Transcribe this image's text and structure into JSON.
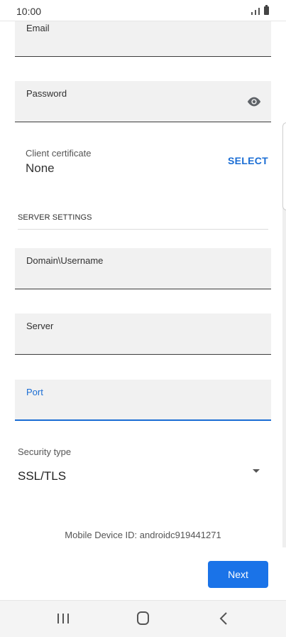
{
  "status_bar": {
    "time": "10:00"
  },
  "fields": {
    "email_label": "Email",
    "password_label": "Password",
    "domain_username_label": "Domain\\Username",
    "server_label": "Server",
    "port_label": "Port"
  },
  "certificate": {
    "label": "Client certificate",
    "value": "None",
    "select_label": "SELECT"
  },
  "server_settings": {
    "heading": "SERVER SETTINGS"
  },
  "security": {
    "label": "Security type",
    "value": "SSL/TLS"
  },
  "device": {
    "id_text": "Mobile Device ID: androidc919441271"
  },
  "actions": {
    "next_label": "Next"
  },
  "icons": {
    "password_toggle": "eye-icon",
    "dropdown": "dropdown-arrow-icon",
    "nav_recent": "recent-apps-icon",
    "nav_home": "home-icon",
    "nav_back": "back-icon"
  },
  "colors": {
    "accent": "#1a73e8",
    "field_bg": "#f1f1f1"
  }
}
